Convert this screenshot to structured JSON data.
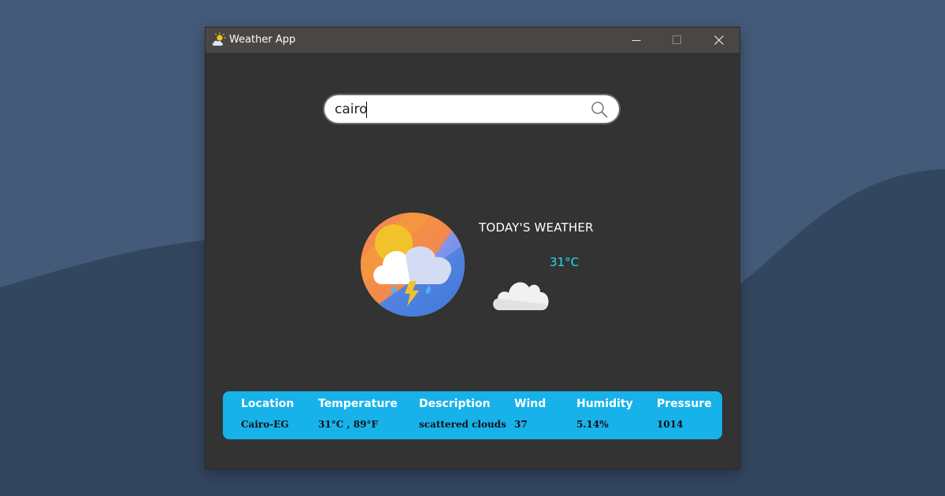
{
  "window": {
    "title": "Weather App",
    "icon": "partly-cloudy-icon"
  },
  "search": {
    "value": "cairo",
    "icon": "search-icon"
  },
  "today": {
    "heading": "TODAY'S WEATHER",
    "temperature": "31°C",
    "condition_icon": "cloud-icon",
    "logo_icon": "thunderstorm-logo-icon"
  },
  "info": {
    "headers": [
      "Location",
      "Temperature",
      "Description",
      "Wind",
      "Humidity",
      "Pressure"
    ],
    "values": [
      "Cairo-EG",
      "31°C , 89°F",
      "scattered clouds",
      "37",
      "5.14%",
      "1014"
    ]
  },
  "colors": {
    "desktop_bg": "#435a78",
    "desktop_wave": "#33465f",
    "window_bg": "#333333",
    "titlebar_bg": "#4a4644",
    "panel_bg": "#17b2ea",
    "temp_accent": "#1ee0f0"
  }
}
